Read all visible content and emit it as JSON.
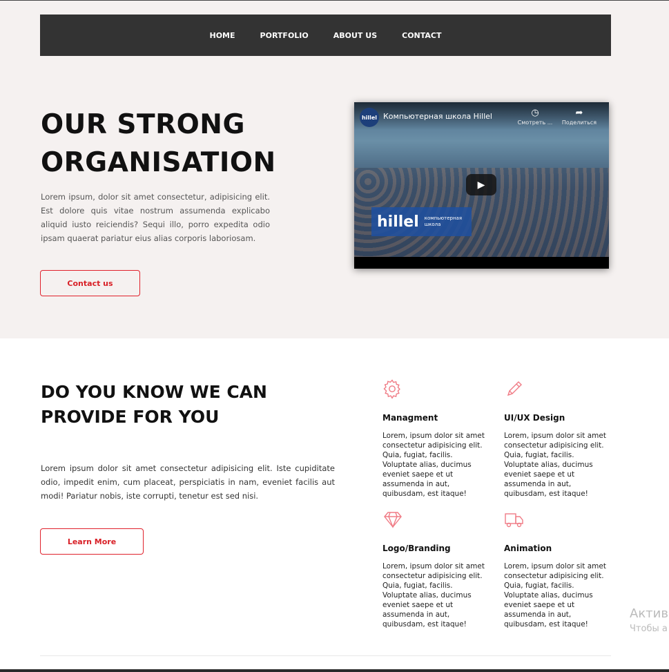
{
  "nav": {
    "items": [
      "HOME",
      "PORTFOLIO",
      "ABOUT US",
      "CONTACT"
    ]
  },
  "hero": {
    "title_line1": "OUR STRONG",
    "title_line2": "ORGANISATION",
    "text": "Lorem ipsum, dolor sit amet consectetur, adipisicing elit. Est dolore quis vitae nostrum assumenda explicabo aliquid iusto reiciendis? Sequi illo, porro expedita odio ipsam quaerat pariatur eius alias corporis laboriosam.",
    "button_label": "Contact us"
  },
  "video": {
    "channel_logo": "hillel",
    "title": "Компьютерная школа Hillel",
    "watch_label": "Смотреть ...",
    "share_label": "Поделиться",
    "banner_logo": "hillel",
    "banner_sub": "компьютерная школа"
  },
  "services": {
    "title_line1": "DO YOU KNOW WE CAN",
    "title_line2": "PROVIDE FOR YOU",
    "text": "Lorem ipsum dolor sit amet consectetur adipisicing elit. Iste cupiditate odio, impedit enim, cum placeat, perspiciatis in nam, eveniet facilis aut modi! Pariatur nobis, iste corrupti, tenetur est sed nisi.",
    "button_label": "Learn More",
    "items": [
      {
        "name": "Managment",
        "icon": "gear-icon",
        "desc": "Lorem, ipsum dolor sit amet consectetur adipisicing elit. Quia, fugiat, facilis. Voluptate alias, ducimus eveniet saepe et ut assumenda in aut, quibusdam, est itaque!"
      },
      {
        "name": "UI/UX Design",
        "icon": "pencil-icon",
        "desc": "Lorem, ipsum dolor sit amet consectetur adipisicing elit. Quia, fugiat, facilis. Voluptate alias, ducimus eveniet saepe et ut assumenda in aut, quibusdam, est itaque!"
      },
      {
        "name": "Logo/Branding",
        "icon": "diamond-icon",
        "desc": "Lorem, ipsum dolor sit amet consectetur adipisicing elit. Quia, fugiat, facilis. Voluptate alias, ducimus eveniet saepe et ut assumenda in aut, quibusdam, est itaque!"
      },
      {
        "name": "Animation",
        "icon": "truck-icon",
        "desc": "Lorem, ipsum dolor sit amet consectetur adipisicing elit. Quia, fugiat, facilis. Voluptate alias, ducimus eveniet saepe et ut assumenda in aut, quibusdam, est itaque!"
      }
    ]
  },
  "watermark": {
    "line1": "Актива",
    "line2": "Чтобы а"
  },
  "colors": {
    "accent": "#e0202b",
    "nav_bg": "#333333",
    "hero_bg": "#f5f1f0",
    "icon": "#f07b85"
  }
}
